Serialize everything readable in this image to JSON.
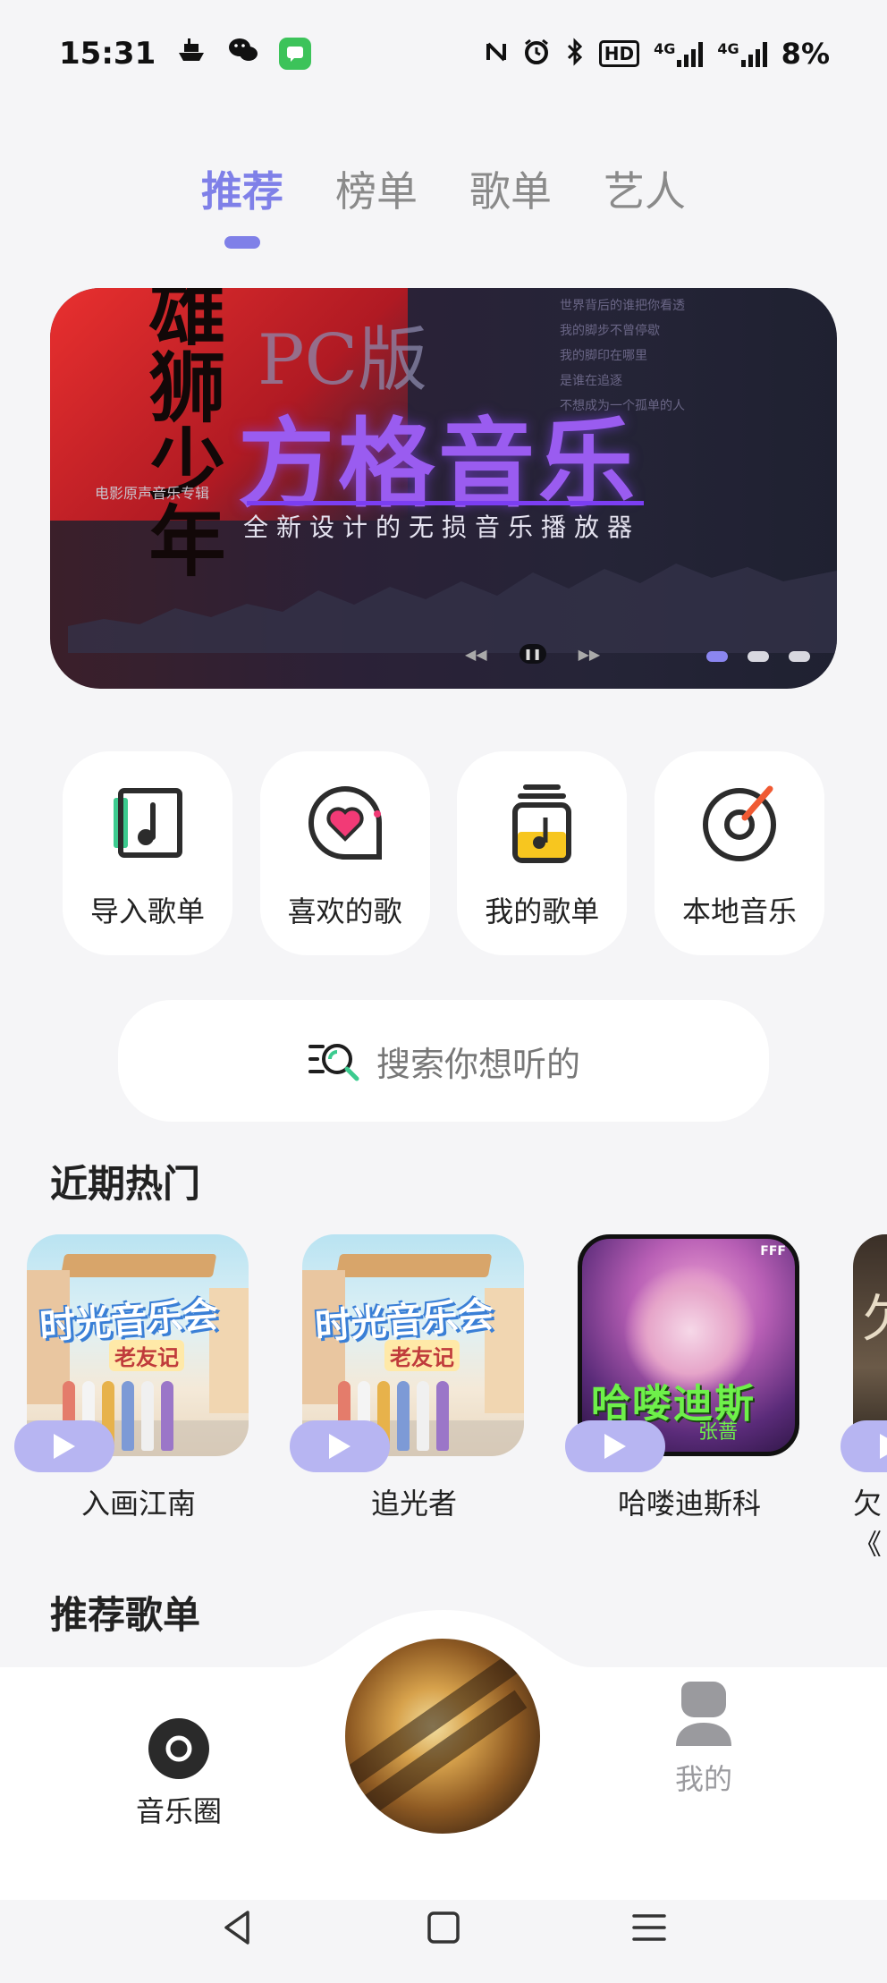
{
  "status_bar": {
    "time": "15:31",
    "network_label": "4G",
    "hd_label": "HD",
    "battery": "8%"
  },
  "tabs": [
    {
      "label": "推荐",
      "active": true
    },
    {
      "label": "榜单",
      "active": false
    },
    {
      "label": "歌单",
      "active": false
    },
    {
      "label": "艺人",
      "active": false
    }
  ],
  "banner": {
    "badge": "PC版",
    "title": "方格音乐",
    "subtitle": "全新设计的无损音乐播放器",
    "album_caption": "电影原声音乐专辑",
    "calligraphy": "雄狮少年",
    "lyrics": [
      "世界背后的谁把你看透",
      "我的脚步不曾停歇",
      "我的脚印在哪里",
      "是谁在追逐",
      "不想成为一个孤单的人"
    ],
    "dots": 3,
    "active_dot": 0
  },
  "quick_actions": [
    {
      "label": "导入歌单",
      "icon": "import-playlist-icon"
    },
    {
      "label": "喜欢的歌",
      "icon": "heart-chat-icon"
    },
    {
      "label": "我的歌单",
      "icon": "my-playlist-icon"
    },
    {
      "label": "本地音乐",
      "icon": "vinyl-disc-icon"
    }
  ],
  "search": {
    "placeholder": "搜索你想听的"
  },
  "sections": {
    "hot": "近期热门",
    "recommended": "推荐歌单"
  },
  "hot_songs": [
    {
      "name": "入画江南",
      "cover_title": "时光音乐会",
      "cover_sub": "老友记"
    },
    {
      "name": "追光者",
      "cover_title": "时光音乐会",
      "cover_sub": "老友记"
    },
    {
      "name": "哈喽迪斯科",
      "cover_title": "哈喽迪斯科",
      "cover_sub": "张蔷"
    },
    {
      "name": "欠",
      "subline": "《"
    }
  ],
  "bottom_nav": {
    "left_label": "音乐圈",
    "right_label": "我的"
  },
  "colors": {
    "accent": "#7f80e8",
    "background": "#f5f5f7",
    "play_pill": "#b7b5f2",
    "rock_green": "#6ef04a"
  }
}
